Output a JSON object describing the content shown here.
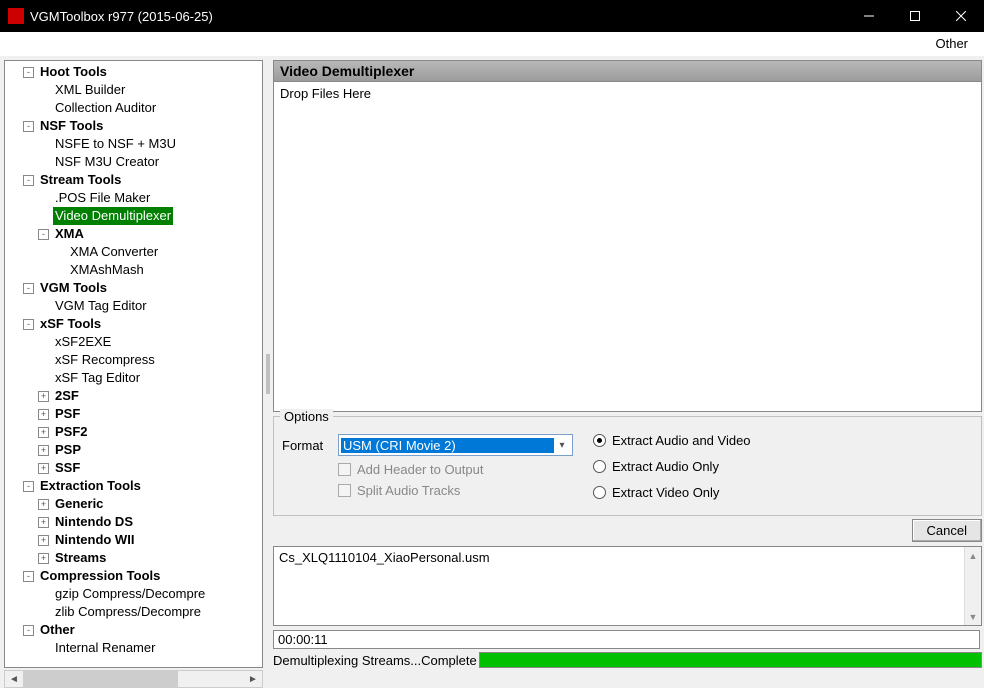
{
  "window": {
    "title": "VGMToolbox r977 (2015-06-25)"
  },
  "menubar": {
    "other": "Other"
  },
  "tree": [
    {
      "depth": 0,
      "toggle": "-",
      "bold": true,
      "label": "Hoot Tools"
    },
    {
      "depth": 1,
      "toggle": " ",
      "label": "XML Builder"
    },
    {
      "depth": 1,
      "toggle": " ",
      "label": "Collection Auditor"
    },
    {
      "depth": 0,
      "toggle": "-",
      "bold": true,
      "label": "NSF Tools"
    },
    {
      "depth": 1,
      "toggle": " ",
      "label": "NSFE to NSF + M3U"
    },
    {
      "depth": 1,
      "toggle": " ",
      "label": "NSF M3U Creator"
    },
    {
      "depth": 0,
      "toggle": "-",
      "bold": true,
      "label": "Stream Tools"
    },
    {
      "depth": 1,
      "toggle": " ",
      "label": ".POS File Maker"
    },
    {
      "depth": 1,
      "toggle": " ",
      "label": "Video Demultiplexer",
      "selected": true
    },
    {
      "depth": 1,
      "toggle": "-",
      "bold": true,
      "label": "XMA"
    },
    {
      "depth": 2,
      "toggle": " ",
      "label": "XMA Converter"
    },
    {
      "depth": 2,
      "toggle": " ",
      "label": "XMAshMash"
    },
    {
      "depth": 0,
      "toggle": "-",
      "bold": true,
      "label": "VGM Tools"
    },
    {
      "depth": 1,
      "toggle": " ",
      "label": "VGM Tag Editor"
    },
    {
      "depth": 0,
      "toggle": "-",
      "bold": true,
      "label": "xSF Tools"
    },
    {
      "depth": 1,
      "toggle": " ",
      "label": "xSF2EXE"
    },
    {
      "depth": 1,
      "toggle": " ",
      "label": "xSF Recompress"
    },
    {
      "depth": 1,
      "toggle": " ",
      "label": "xSF Tag Editor"
    },
    {
      "depth": 1,
      "toggle": "+",
      "bold": true,
      "label": "2SF"
    },
    {
      "depth": 1,
      "toggle": "+",
      "bold": true,
      "label": "PSF"
    },
    {
      "depth": 1,
      "toggle": "+",
      "bold": true,
      "label": "PSF2"
    },
    {
      "depth": 1,
      "toggle": "+",
      "bold": true,
      "label": "PSP"
    },
    {
      "depth": 1,
      "toggle": "+",
      "bold": true,
      "label": "SSF"
    },
    {
      "depth": 0,
      "toggle": "-",
      "bold": true,
      "label": "Extraction Tools"
    },
    {
      "depth": 1,
      "toggle": "+",
      "bold": true,
      "label": "Generic"
    },
    {
      "depth": 1,
      "toggle": "+",
      "bold": true,
      "label": "Nintendo DS"
    },
    {
      "depth": 1,
      "toggle": "+",
      "bold": true,
      "label": "Nintendo WII"
    },
    {
      "depth": 1,
      "toggle": "+",
      "bold": true,
      "label": "Streams"
    },
    {
      "depth": 0,
      "toggle": "-",
      "bold": true,
      "label": "Compression Tools"
    },
    {
      "depth": 1,
      "toggle": " ",
      "label": "gzip Compress/Decompre"
    },
    {
      "depth": 1,
      "toggle": " ",
      "label": "zlib Compress/Decompre"
    },
    {
      "depth": 0,
      "toggle": "-",
      "bold": true,
      "label": "Other"
    },
    {
      "depth": 1,
      "toggle": " ",
      "label": "Internal Renamer"
    }
  ],
  "panel": {
    "title": "Video Demultiplexer",
    "drop_hint": "Drop Files Here",
    "options_legend": "Options",
    "format_label": "Format",
    "format_value": "USM (CRI Movie 2)",
    "chk_add_header": "Add Header to Output",
    "chk_split_audio": "Split Audio Tracks",
    "radio_av": "Extract Audio and Video",
    "radio_a": "Extract Audio Only",
    "radio_v": "Extract Video Only",
    "cancel": "Cancel"
  },
  "log": {
    "line1": "Cs_XLQ1110104_XiaoPersonal.usm"
  },
  "timer": "00:00:11",
  "status": "Demultiplexing Streams...Complete"
}
